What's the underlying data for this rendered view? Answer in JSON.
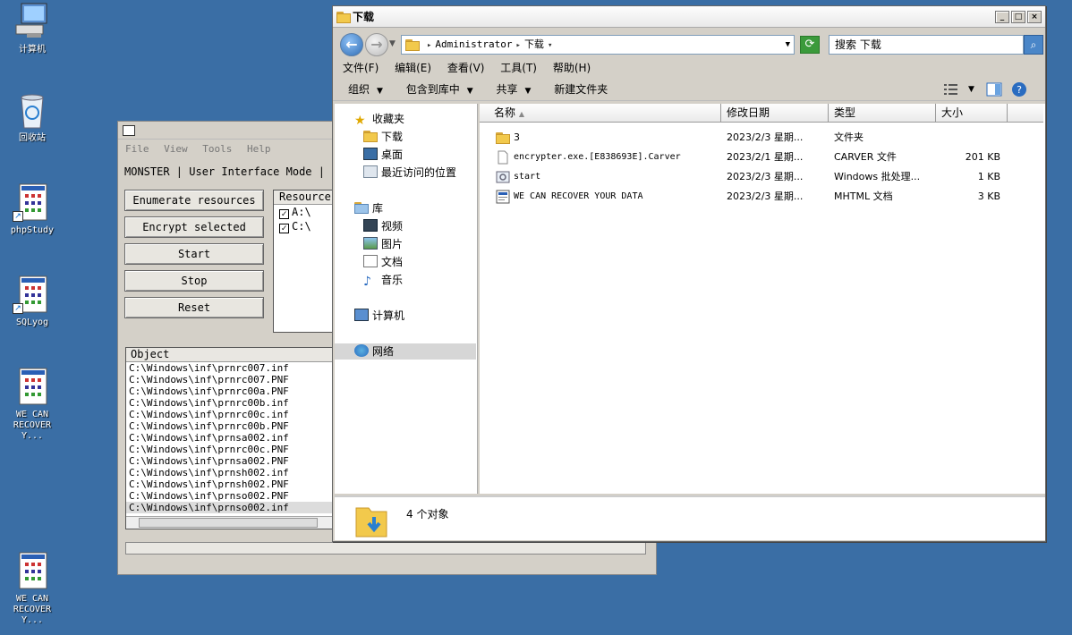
{
  "desktop": {
    "icons": [
      {
        "label": "计算机",
        "icon": "computer-icon"
      },
      {
        "label": "回收站",
        "icon": "recycle-bin-icon"
      },
      {
        "label": "phpStudy",
        "icon": "app-icon"
      },
      {
        "label": "SQLyog",
        "icon": "app-icon"
      },
      {
        "label": "WE CAN\nRECOVER Y...",
        "icon": "document-icon"
      },
      {
        "label": "WE CAN\nRECOVER Y...",
        "icon": "document-icon"
      }
    ]
  },
  "monster": {
    "menu": [
      "File",
      "View",
      "Tools",
      "Help"
    ],
    "mode_line": "MONSTER | User Interface Mode | P",
    "buttons": {
      "enumerate": "Enumerate resources",
      "encrypt": "Encrypt selected",
      "start": "Start",
      "stop": "Stop",
      "reset": "Reset"
    },
    "resource_header": "Resource",
    "resources": [
      {
        "label": "A:\\",
        "checked": true
      },
      {
        "label": "C:\\",
        "checked": true
      }
    ],
    "object_header": "Object",
    "objects": [
      "C:\\Windows\\inf\\prnrc007.inf",
      "C:\\Windows\\inf\\prnrc007.PNF",
      "C:\\Windows\\inf\\prnrc00a.PNF",
      "C:\\Windows\\inf\\prnrc00b.inf",
      "C:\\Windows\\inf\\prnrc00c.inf",
      "C:\\Windows\\inf\\prnrc00b.PNF",
      "C:\\Windows\\inf\\prnsa002.inf",
      "C:\\Windows\\inf\\prnrc00c.PNF",
      "C:\\Windows\\inf\\prnsa002.PNF",
      "C:\\Windows\\inf\\prnsh002.inf",
      "C:\\Windows\\inf\\prnsh002.PNF",
      "C:\\Windows\\inf\\prnso002.PNF",
      "C:\\Windows\\inf\\prnso002.inf"
    ]
  },
  "explorer": {
    "title": "下载",
    "address": {
      "part1": "Administrator",
      "part2": "下载"
    },
    "search_placeholder": "搜索 下载",
    "menu": [
      "文件(F)",
      "编辑(E)",
      "查看(V)",
      "工具(T)",
      "帮助(H)"
    ],
    "commands": {
      "organize": "组织",
      "include": "包含到库中",
      "share": "共享",
      "new_folder": "新建文件夹"
    },
    "nav": {
      "favorites": "收藏夹",
      "downloads": "下载",
      "desktop": "桌面",
      "recent": "最近访问的位置",
      "libraries": "库",
      "videos": "视频",
      "pictures": "图片",
      "documents": "文档",
      "music": "音乐",
      "computer": "计算机",
      "network": "网络"
    },
    "columns": {
      "name": "名称",
      "date": "修改日期",
      "type": "类型",
      "size": "大小"
    },
    "files": [
      {
        "name": "3",
        "date": "2023/2/3 星期...",
        "type": "文件夹",
        "size": "",
        "icon": "folder-icon"
      },
      {
        "name": "encrypter.exe.[E838693E].Carver",
        "date": "2023/2/1 星期...",
        "type": "CARVER 文件",
        "size": "201 KB",
        "icon": "blank-file-icon"
      },
      {
        "name": "start",
        "date": "2023/2/3 星期...",
        "type": "Windows 批处理...",
        "size": "1 KB",
        "icon": "batch-file-icon"
      },
      {
        "name": "WE CAN RECOVER YOUR DATA",
        "date": "2023/2/3 星期...",
        "type": "MHTML 文档",
        "size": "3 KB",
        "icon": "mhtml-file-icon"
      }
    ],
    "status": "4 个对象"
  },
  "colors": {
    "desktop": "#3a6ea5",
    "folder": "#f2c94c",
    "accent": "#2f6db5"
  }
}
